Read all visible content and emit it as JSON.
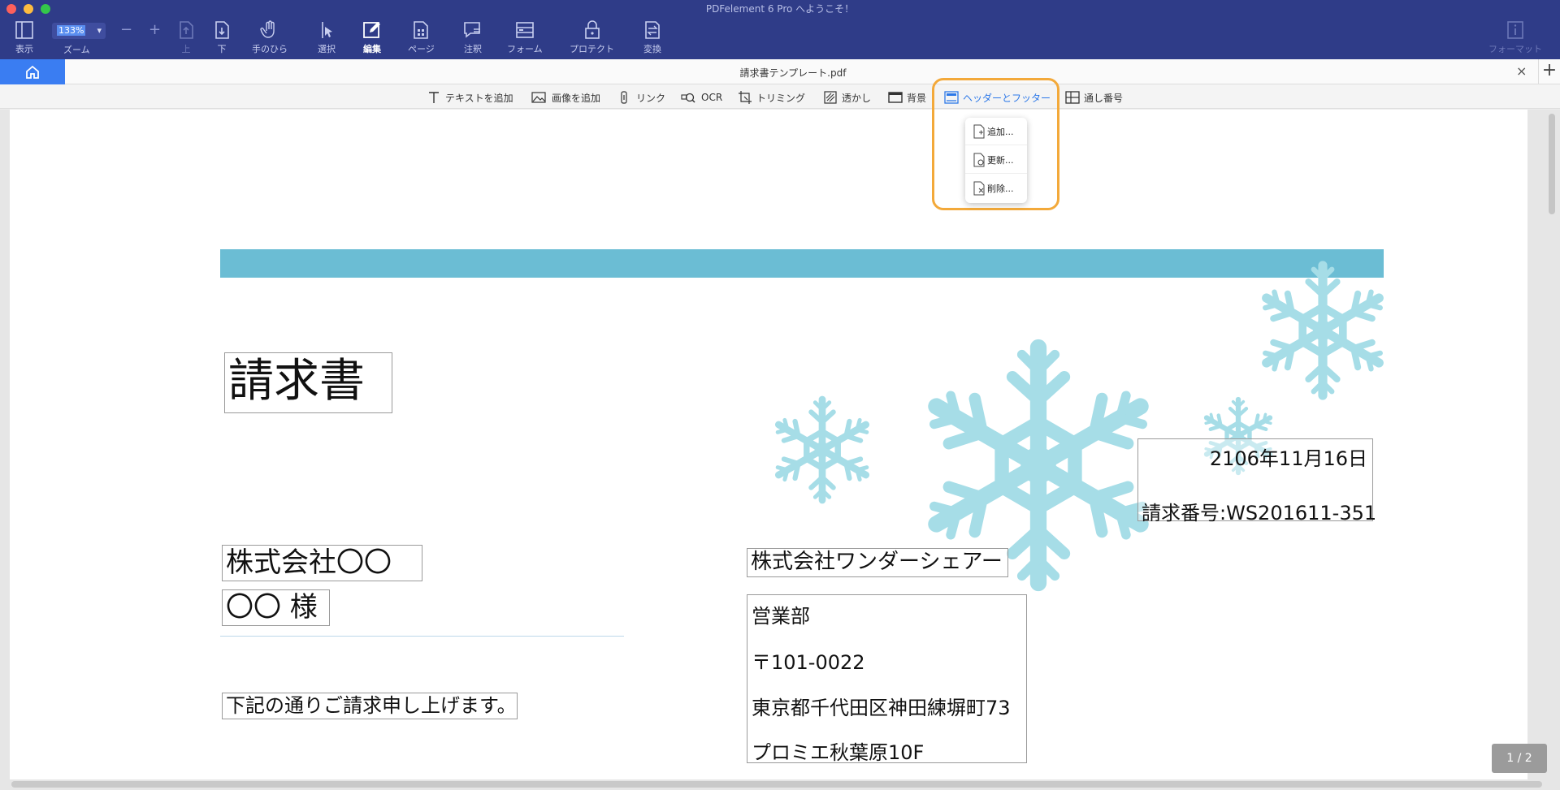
{
  "app": {
    "title": "PDFelement 6 Pro へようこそ！"
  },
  "toolbar": {
    "view_label": "表示",
    "zoom_value": "133%",
    "zoom_label": "ズーム",
    "zoom_out": "−",
    "zoom_in": "+",
    "up_label": "上",
    "down_label": "下",
    "hand_label": "手のひら",
    "select_label": "選択",
    "edit_label": "編集",
    "page_label": "ページ",
    "comment_label": "注釈",
    "form_label": "フォーム",
    "protect_label": "プロテクト",
    "convert_label": "変換",
    "format_label": "フォーマット"
  },
  "tab": {
    "title": "請求書テンプレート.pdf",
    "close": "×",
    "add": "+"
  },
  "edit_toolbar": {
    "add_text": "テキストを追加",
    "add_image": "画像を追加",
    "link": "リンク",
    "ocr": "OCR",
    "crop": "トリミング",
    "watermark": "透かし",
    "background": "背景",
    "header_footer": "ヘッダーとフッター",
    "bates": "通し番号"
  },
  "header_footer_menu": {
    "add": "追加...",
    "update": "更新...",
    "remove": "削除..."
  },
  "document": {
    "title": "請求書",
    "client_company": "株式会社〇〇",
    "client_person": "〇〇 様",
    "request_text": "下記の通りご請求申し上げます。",
    "sender_company": "株式会社ワンダーシェアー",
    "sender_dept": "営業部",
    "sender_postal": "〒101-0022",
    "sender_address1": "東京都千代田区神田練塀町73",
    "sender_address2": "プロミエ秋葉原10F",
    "date": "2106年11月16日",
    "invoice_no": "請求番号:WS201611-351"
  },
  "page_indicator": "1 / 2",
  "colors": {
    "titlebar": "#2f3c88",
    "accent": "#3a7df2",
    "band": "#6bbdd4",
    "snowflake": "#a6dde7",
    "highlight": "#f3a93a"
  }
}
